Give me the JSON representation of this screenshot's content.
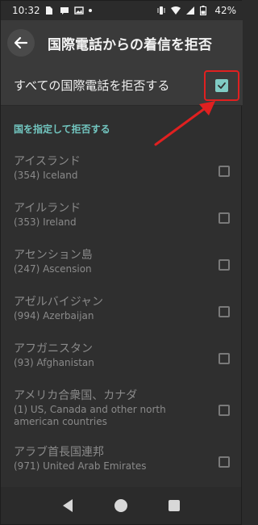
{
  "status_bar": {
    "time": "10:32",
    "battery": "42%",
    "left_icons": [
      "sim-icon",
      "message-icon",
      "image-icon",
      "dot-icon"
    ],
    "right_icons": [
      "vibrate-icon",
      "wifi-icon",
      "signal-icon",
      "battery-icon"
    ]
  },
  "app_bar": {
    "title": "国際電話からの着信を拒否"
  },
  "master_setting": {
    "label": "すべての国際電話を拒否する",
    "checked": true
  },
  "section": {
    "header": "国を指定して拒否する"
  },
  "countries": [
    {
      "name": "アイスランド",
      "code": "(354) Iceland",
      "checked": false
    },
    {
      "name": "アイルランド",
      "code": "(353) Ireland",
      "checked": false
    },
    {
      "name": "アセンション島",
      "code": "(247) Ascension",
      "checked": false
    },
    {
      "name": "アゼルバイジャン",
      "code": "(994) Azerbaijan",
      "checked": false
    },
    {
      "name": "アフガニスタン",
      "code": "(93) Afghanistan",
      "checked": false
    },
    {
      "name": "アメリカ合衆国、カナダ",
      "code": "(1) US, Canada and other north american countries",
      "checked": false
    },
    {
      "name": "アラブ首長国連邦",
      "code": "(971) United Arab Emirates",
      "checked": false
    }
  ],
  "colors": {
    "accent": "#80cbc4",
    "section_header": "#72c6c0",
    "annotation": "#e02020",
    "disabled_text": "#8a8a8a"
  }
}
